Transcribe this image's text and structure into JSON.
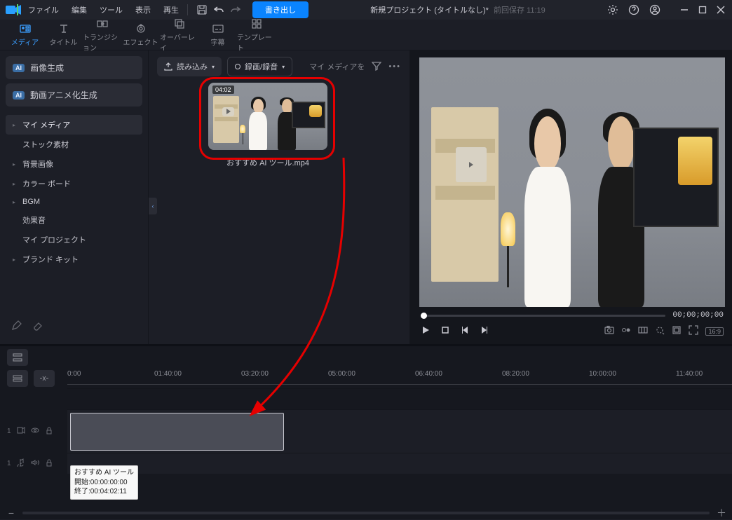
{
  "titlebar": {
    "menus": [
      "ファイル",
      "編集",
      "ツール",
      "表示",
      "再生"
    ],
    "export": "書き出し",
    "project_title": "新規プロジェクト (タイトルなし)*",
    "saved_label": "前回保存 11:19"
  },
  "tabs": [
    {
      "label": "メディア",
      "active": true
    },
    {
      "label": "タイトル",
      "active": false
    },
    {
      "label": "トランジション",
      "active": false
    },
    {
      "label": "エフェクト",
      "active": false
    },
    {
      "label": "オーバーレイ",
      "active": false
    },
    {
      "label": "字幕",
      "active": false
    },
    {
      "label": "テンプレート",
      "active": false
    }
  ],
  "sidebar": {
    "ai_image": "画像生成",
    "ai_anime": "動画アニメ化生成",
    "items": [
      {
        "label": "マイ メディア",
        "active": true,
        "expand": true
      },
      {
        "label": "ストック素材",
        "sub": true
      },
      {
        "label": "背景画像",
        "expand": true
      },
      {
        "label": "カラー ボード",
        "expand": true
      },
      {
        "label": "BGM",
        "expand": true
      },
      {
        "label": "効果音",
        "sub": true
      },
      {
        "label": "マイ プロジェクト",
        "sub": true
      },
      {
        "label": "ブランド キット",
        "expand": true
      }
    ]
  },
  "media_toolbar": {
    "import": "読み込み",
    "record": "録画/録音",
    "my_media": "マイ メディアを"
  },
  "clip": {
    "duration": "04:02",
    "filename": "おすすめ AI ツール.mp4"
  },
  "preview": {
    "timecode": "00;00;00;00",
    "aspect": "16:9"
  },
  "timeline": {
    "ruler": [
      "0:00",
      "01:40:00",
      "03:20:00",
      "05:00:00",
      "06:40:00",
      "08:20:00",
      "10:00:00",
      "11:40:00"
    ],
    "track_video": "1",
    "track_audio": "1",
    "tooltip": {
      "name": "おすすめ AI ツール",
      "start_label": "開始:",
      "start": "00:00:00:00",
      "end_label": "終了:",
      "end": "00:04:02:11"
    }
  }
}
